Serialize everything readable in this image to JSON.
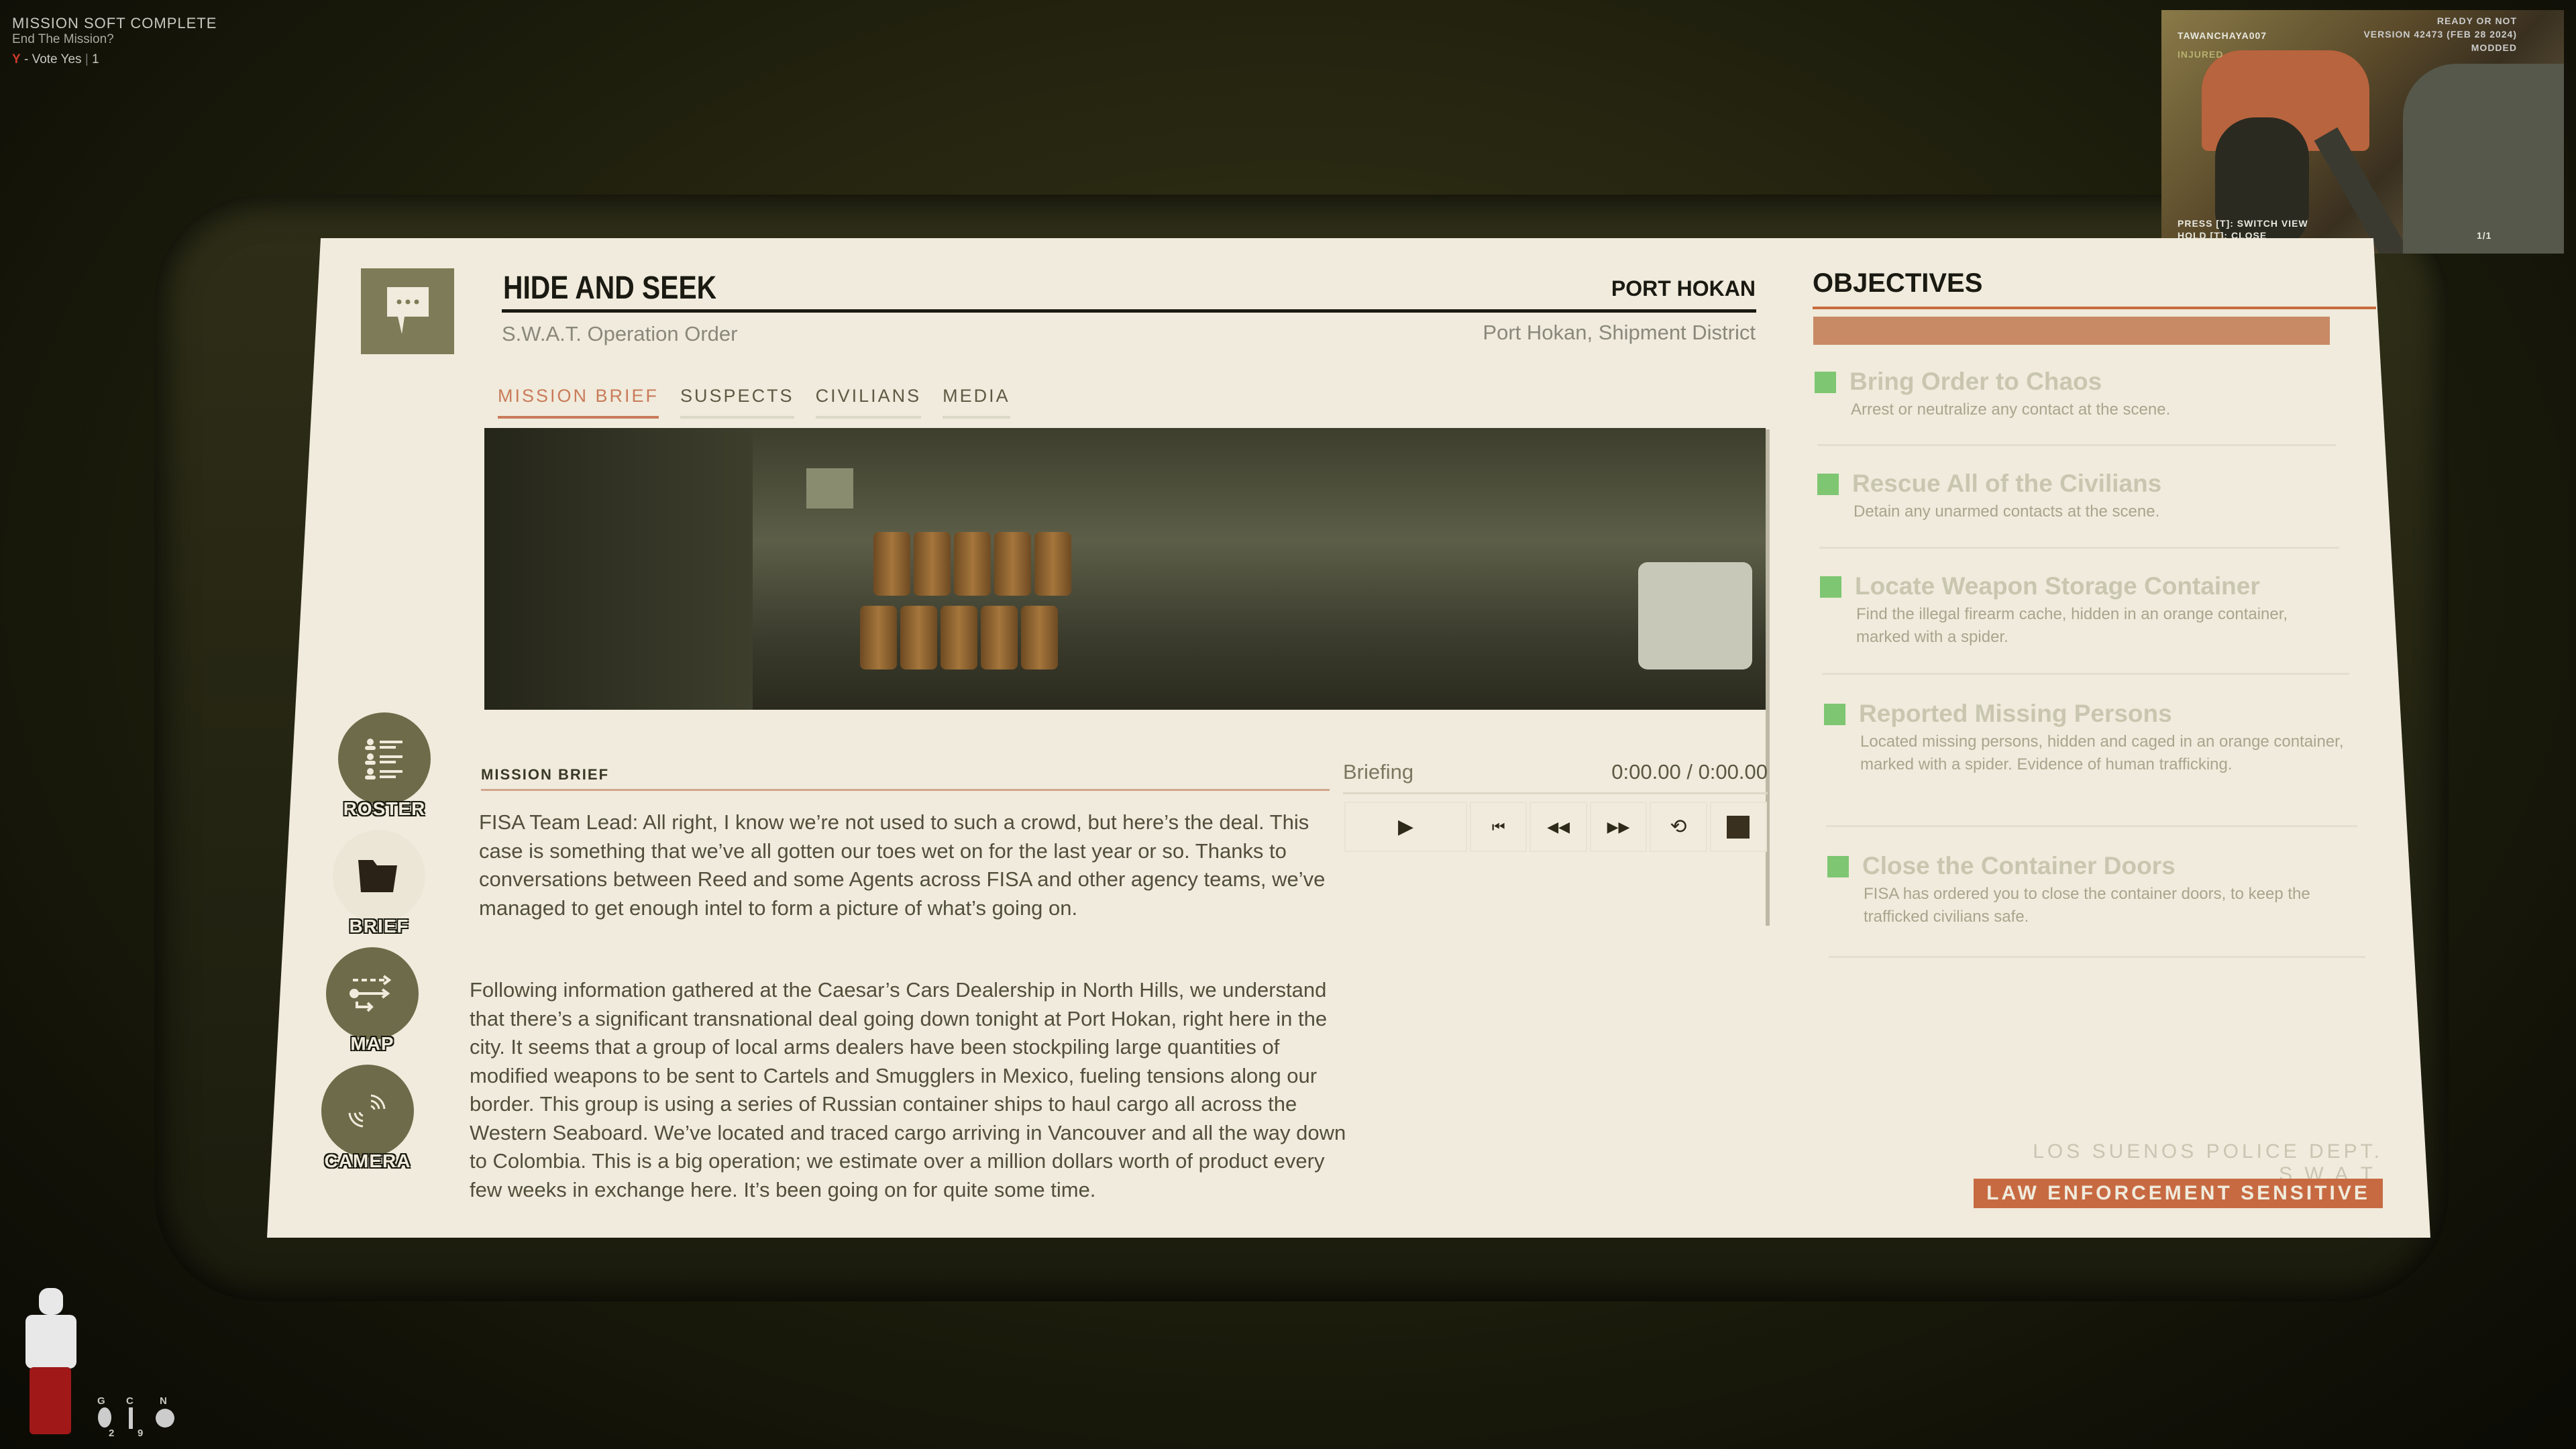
{
  "hud": {
    "vote_title": "MISSION SOFT COMPLETE",
    "vote_question": "End The Mission?",
    "vote_key": "Y",
    "vote_action": "- Vote Yes",
    "vote_count": "1"
  },
  "camera_feed": {
    "player": "TAWANCHAYA007",
    "status": "INJURED",
    "game": "READY OR NOT",
    "version": "VERSION 42473 (FEB 28 2024)",
    "modded": "MODDED",
    "hint_switch": "PRESS [T]: SWITCH VIEW",
    "hint_close": "HOLD [T]: CLOSE",
    "page": "1/1"
  },
  "header": {
    "title": "HIDE AND SEEK",
    "subtitle": "S.W.A.T. Operation Order",
    "location": "PORT HOKAN",
    "location_detail": "Port Hokan, Shipment District",
    "icon": "chat-bubble-icon"
  },
  "tabs": [
    {
      "label": "MISSION BRIEF",
      "active": true
    },
    {
      "label": "SUSPECTS"
    },
    {
      "label": "CIVILIANS"
    },
    {
      "label": "MEDIA"
    }
  ],
  "nav": [
    {
      "label": "ROSTER",
      "icon": "roster-icon"
    },
    {
      "label": "BRIEF",
      "icon": "folder-icon",
      "selected": true
    },
    {
      "label": "MAP",
      "icon": "map-route-icon"
    },
    {
      "label": "CAMERA",
      "icon": "camera-signal-icon"
    }
  ],
  "brief": {
    "label": "MISSION BRIEF",
    "paragraphs": [
      "FISA Team Lead: All right, I know we’re not used to such a crowd, but here’s the deal. This case is something that we’ve all gotten our toes wet on for the last year or so.  Thanks to conversations between Reed and some Agents across FISA and other agency teams, we’ve managed to get enough intel to form a picture of what’s going on.",
      "Following information gathered at the Caesar’s Cars Dealership in North Hills, we understand that there’s a significant transnational deal going down tonight at Port Hokan, right here in the city. It seems that a group of local arms dealers have been stockpiling large quantities of modified weapons to be sent to Cartels and Smugglers in Mexico, fueling tensions along our border. This group is using a series of Russian container ships to haul cargo all across the Western Seaboard. We’ve located and traced cargo arriving in Vancouver and all the way down to Colombia. This is a big operation; we estimate over a million dollars worth of product every few weeks in exchange here. It’s been going on for quite some time."
    ]
  },
  "player": {
    "track": "Briefing",
    "time": "0:00.00 / 0:00.00",
    "controls": [
      "play-icon",
      "skip-back-icon",
      "rewind-icon",
      "fast-forward-icon",
      "loop-icon",
      "stop-icon"
    ]
  },
  "objectives": {
    "title": "OBJECTIVES",
    "items": [
      {
        "title": "Bring Order to Chaos",
        "desc": "Arrest or neutralize any contact at the scene.",
        "status": "complete"
      },
      {
        "title": "Rescue All of the Civilians",
        "desc": "Detain any unarmed contacts at the scene.",
        "status": "complete"
      },
      {
        "title": "Locate Weapon Storage Container",
        "desc": "Find the illegal firearm cache, hidden in an orange container, marked with a spider.",
        "status": "complete"
      },
      {
        "title": "Reported Missing Persons",
        "desc": "Located missing persons, hidden and caged in an orange container, marked with a spider. Evidence of human trafficking.",
        "status": "complete"
      },
      {
        "title": "Close the Container Doors",
        "desc": "FISA has ordered you to close the container doors, to keep the trafficked civilians safe.",
        "status": "complete"
      }
    ]
  },
  "footer": {
    "dept": "LOS SUENOS POLICE DEPT. S.W.A.T.",
    "badge": "LAW ENFORCEMENT SENSITIVE"
  },
  "equipment": [
    {
      "key": "G",
      "count": "2"
    },
    {
      "key": "C",
      "count": "9"
    },
    {
      "key": "N",
      "count": ""
    }
  ],
  "colors": {
    "accent": "#c76a42",
    "complete": "#7ec672",
    "panel": "#f0ebdc",
    "nav": "#6e6b4a"
  }
}
